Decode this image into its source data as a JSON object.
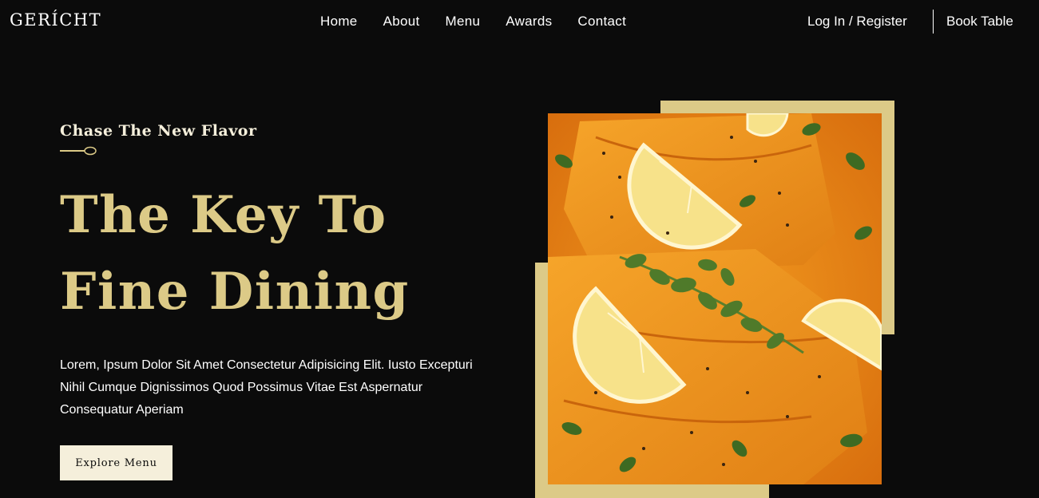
{
  "brand": {
    "logo": "GERÍCHT"
  },
  "nav": {
    "links": [
      "Home",
      "About",
      "Menu",
      "Awards",
      "Contact"
    ],
    "login": "Log In / Register",
    "book": "Book Table"
  },
  "hero": {
    "subtitle": "Chase The New Flavor",
    "headline_line1": "The Key To",
    "headline_line2": "Fine Dining",
    "description": "Lorem, Ipsum Dolor Sit Amet Consectetur Adipisicing Elit. Iusto Excepturi Nihil Cumque Dignissimos Quod Possimus Vitae Est Aspernatur Consequatur Aperiam",
    "button": "Explore Menu"
  },
  "colors": {
    "background": "#0b0b0b",
    "accent_gold": "#dcca87",
    "cream": "#f5efdb"
  },
  "icons": {
    "divider": "spoon-icon"
  }
}
